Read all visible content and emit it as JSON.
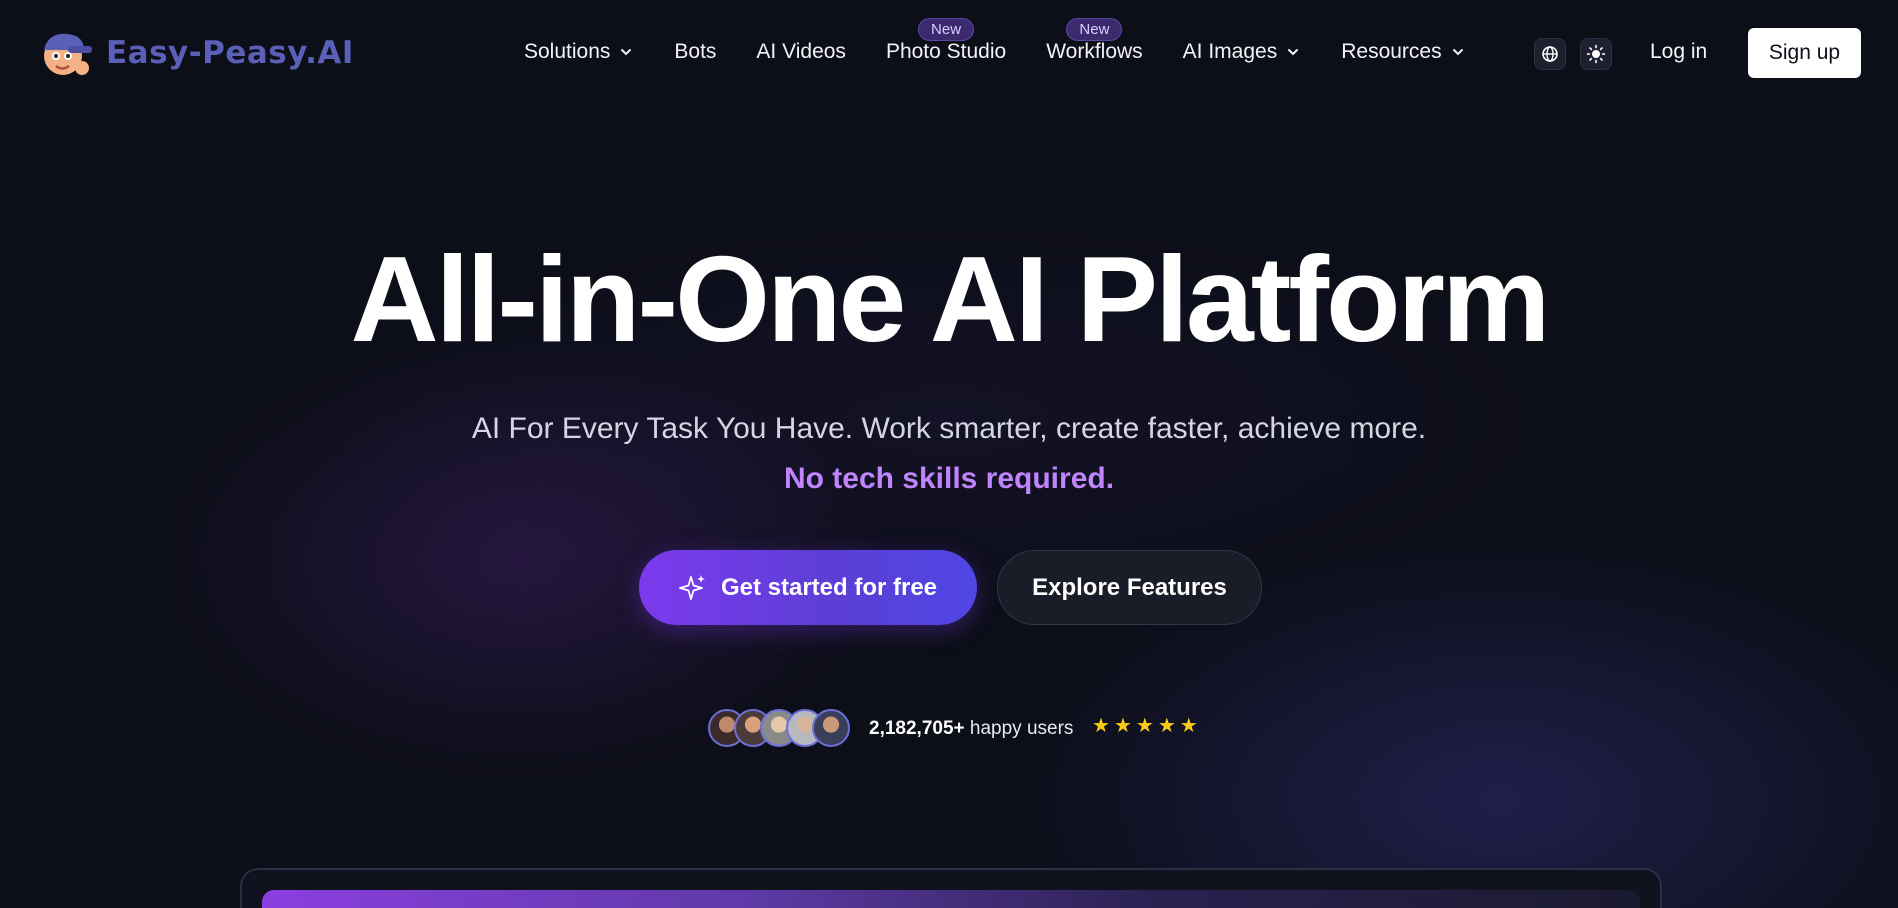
{
  "brand": {
    "name": "Easy-Peasy.AI",
    "color": "#5a5fb8"
  },
  "nav": {
    "items": [
      {
        "label": "Solutions",
        "has_dropdown": true
      },
      {
        "label": "Bots"
      },
      {
        "label": "AI Videos"
      },
      {
        "label": "Photo Studio",
        "badge": "New"
      },
      {
        "label": "Workflows",
        "badge": "New"
      },
      {
        "label": "AI Images",
        "has_dropdown": true
      },
      {
        "label": "Resources",
        "has_dropdown": true
      }
    ],
    "language_icon": "globe-icon",
    "theme_icon": "sun-icon",
    "login_label": "Log in",
    "signup_label": "Sign up"
  },
  "hero": {
    "title": "All-in-One AI Platform",
    "subtitle": "AI For Every Task You Have. Work smarter, create faster, achieve more.",
    "accent": "No tech skills required.",
    "accent_color": "#c084fc",
    "primary_cta": "Get started for free",
    "primary_cta_icon": "sparkle-icon",
    "secondary_cta": "Explore Features"
  },
  "social_proof": {
    "user_count": "2,182,705+",
    "user_suffix": "happy users",
    "rating_stars": 5,
    "star_color": "#facc15",
    "avatar_count": 5
  }
}
